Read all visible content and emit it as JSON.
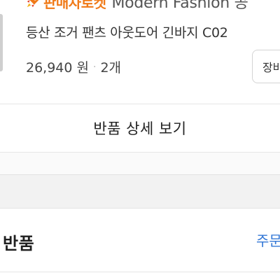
{
  "product": {
    "badge_label": "판매자로켓",
    "seller_name": "Modern Fashion 공",
    "name": "등산 조거 팬츠 아웃도어 긴바지 C02",
    "price": "26,940 원",
    "separator": "·",
    "quantity": "2개",
    "cart_button_label": "장바"
  },
  "return_detail": {
    "label": "반품 상세 보기"
  },
  "return_section": {
    "title": "반품",
    "order_link_label": "주문"
  },
  "colors": {
    "badge": "#f07a18",
    "link": "#3478d6"
  },
  "icons": {
    "badge_icon": "rocket-icon"
  }
}
